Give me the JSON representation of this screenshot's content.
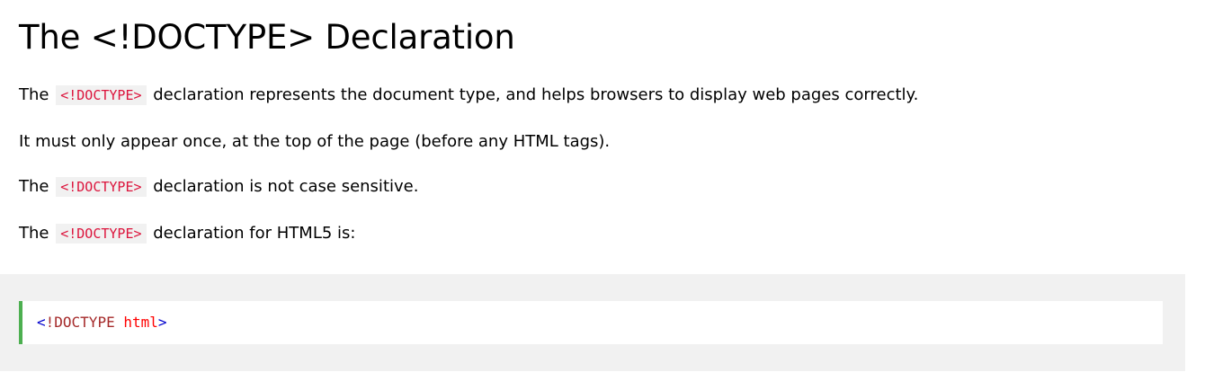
{
  "heading": "The <!DOCTYPE> Declaration",
  "paragraphs": {
    "p1": {
      "before": "The ",
      "code": "<!DOCTYPE>",
      "after": " declaration represents the document type, and helps browsers to display web pages correctly."
    },
    "p2": {
      "text": "It must only appear once, at the top of the page (before any HTML tags)."
    },
    "p3": {
      "before": "The ",
      "code": "<!DOCTYPE>",
      "after": " declaration is not case sensitive."
    },
    "p4": {
      "before": "The ",
      "code": "<!DOCTYPE>",
      "after": " declaration for HTML5 is:"
    }
  },
  "example": {
    "open": "<",
    "keyword": "!DOCTYPE",
    "attr": " html",
    "close": ">"
  },
  "colors": {
    "inline_code_text": "#dc143c",
    "inline_code_bg": "#f1f1f1",
    "example_bg": "#f1f1f1",
    "example_border": "#4caf50",
    "tag_bracket": "#0000cd",
    "tag_name": "#a52a2a",
    "attribute": "#ff0000"
  }
}
